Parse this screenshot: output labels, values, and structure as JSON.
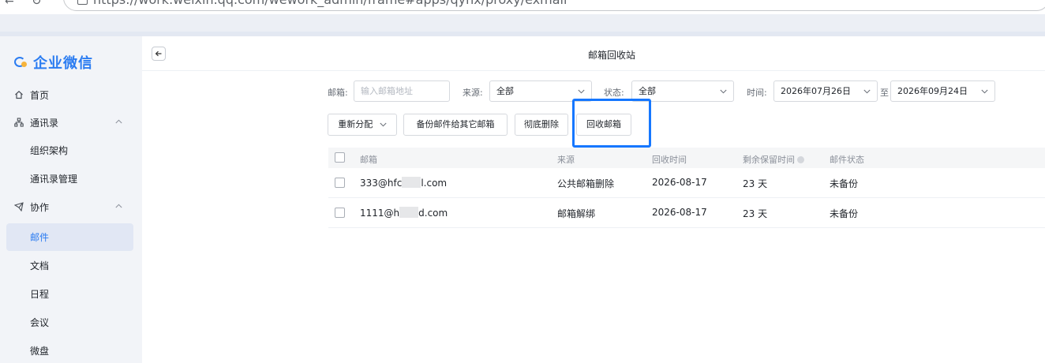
{
  "browser": {
    "url_text": "https://work.weixin.qq.com/wework_admin/frame#apps/qyhx/proxy/exmail",
    "back_icon": "arrow-left-icon",
    "reload_icon": "reload-icon"
  },
  "sidebar": {
    "logo_text": "企业微信",
    "items": [
      {
        "label": "首页",
        "icon": "home-icon"
      },
      {
        "label": "通讯录",
        "icon": "contacts-icon",
        "expanded": true
      },
      {
        "label": "组织架构"
      },
      {
        "label": "通讯录管理"
      },
      {
        "label": "协作",
        "icon": "collaboration-icon",
        "expanded": true
      },
      {
        "label": "邮件",
        "active": true
      },
      {
        "label": "文档"
      },
      {
        "label": "日程"
      },
      {
        "label": "会议"
      },
      {
        "label": "微盘"
      }
    ],
    "chevron": "^"
  },
  "main": {
    "back_label": "←",
    "title": "邮箱回收站",
    "filters": {
      "mailbox_label": "邮箱:",
      "mailbox_placeholder": "输入邮箱地址",
      "source_label": "来源:",
      "source_value": "全部",
      "status_label": "状态:",
      "status_value": "全部",
      "time_label": "时间:",
      "start_date": "2026年07月26日",
      "to_label": "至",
      "end_date": "2026年09月24日",
      "dropdown_glyph": "∨"
    },
    "actions": {
      "reassign": "重新分配",
      "reassign_chevron": "∨",
      "backup": "备份邮件给其它邮箱",
      "delete": "彻底删除",
      "recycle": "回收邮箱"
    },
    "table": {
      "columns": [
        "邮箱",
        "来源",
        "回收时间",
        "剩余保留时间",
        "邮件状态"
      ],
      "rows": [
        {
          "email_prefix": "333@hfc",
          "email_suffix": "l.com",
          "source": "公共邮箱删除",
          "recycle_time": "2026-08-17",
          "remaining": "23 天",
          "status": "未备份"
        },
        {
          "email_prefix": "1111@h",
          "email_suffix": "d.com",
          "source": "邮箱解绑",
          "recycle_time": "2026-08-17",
          "remaining": "23 天",
          "status": "未备份"
        }
      ]
    }
  },
  "colors": {
    "accent": "#2b7cf1",
    "highlight": "#1677ff",
    "sidebar_bg": "#f2f4f8",
    "active_bg": "#e1e7f4"
  }
}
